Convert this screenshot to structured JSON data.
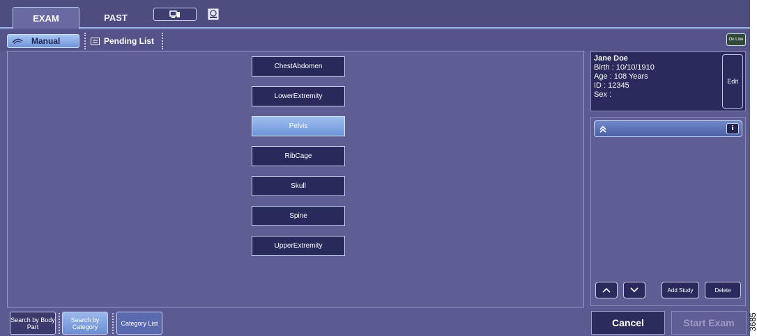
{
  "tabs": {
    "exam": "EXAM",
    "past": "PAST",
    "icon_1": "monitor-icon",
    "icon_2": "disc-icon"
  },
  "subbar": {
    "manual": "Manual",
    "pending": "Pending List",
    "status": "On Line"
  },
  "body_parts": [
    {
      "label": "ChestAbdomen",
      "selected": false
    },
    {
      "label": "LowerExtremity",
      "selected": false
    },
    {
      "label": "Pelvis",
      "selected": true
    },
    {
      "label": "RibCage",
      "selected": false
    },
    {
      "label": "Skull",
      "selected": false
    },
    {
      "label": "Spine",
      "selected": false
    },
    {
      "label": "UpperExtremity",
      "selected": false
    }
  ],
  "patient": {
    "name": "Jane Doe",
    "birth": "Birth : 10/10/1910",
    "age": "Age : 108 Years",
    "id": "ID : 12345",
    "sex": "Sex :",
    "edit": "Edit"
  },
  "study": {
    "collapse_icon": "double-chevron-up-icon",
    "info": "i",
    "add_study": "Add Study",
    "delete": "Delete"
  },
  "bottom": {
    "search_body_part": "Search by Body Part",
    "search_category": "Search by Category",
    "category_list": "Category List",
    "cancel": "Cancel",
    "start_exam": "Start Exam"
  },
  "figure_id": "3685",
  "colors": {
    "background": "#5b5b92",
    "button": "#292a5c",
    "selected": "#6f94d8"
  }
}
